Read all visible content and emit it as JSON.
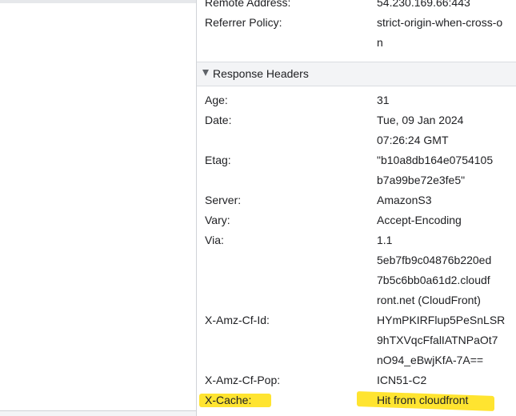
{
  "request": {
    "remote_address_label": "Remote Address:",
    "remote_address_value": "54.230.169.66:443",
    "referrer_label": "Referrer Policy:",
    "referrer_value_lines": [
      "strict-origin-when-cross-o",
      "n"
    ]
  },
  "response_headers": {
    "title": "Response Headers",
    "rows": [
      {
        "key": "Age:",
        "lines": [
          "31"
        ]
      },
      {
        "key": "Date:",
        "lines": [
          "Tue, 09 Jan 2024",
          "07:26:24 GMT"
        ]
      },
      {
        "key": "Etag:",
        "lines": [
          "\"b10a8db164e0754105",
          "b7a99be72e3fe5\""
        ]
      },
      {
        "key": "Server:",
        "lines": [
          "AmazonS3"
        ]
      },
      {
        "key": "Vary:",
        "lines": [
          "Accept-Encoding"
        ]
      },
      {
        "key": "Via:",
        "lines": [
          "1.1",
          "5eb7fb9c04876b220ed",
          "7b5c6bb0a61d2.cloudf",
          "ront.net (CloudFront)"
        ]
      },
      {
        "key": "X-Amz-Cf-Id:",
        "lines": [
          "HYmPKIRFlup5PeSnLSR",
          "9hTXVqcFfalIATNPaOt7",
          "nO94_eBwjKfA-7A=="
        ]
      },
      {
        "key": "X-Amz-Cf-Pop:",
        "lines": [
          "ICN51-C2"
        ]
      },
      {
        "key": "X-Cache:",
        "lines": [
          "Hit from cloudfront"
        ]
      }
    ]
  },
  "colors": {
    "highlight": "#ffe11a",
    "header_bg": "#f3f4f6"
  }
}
